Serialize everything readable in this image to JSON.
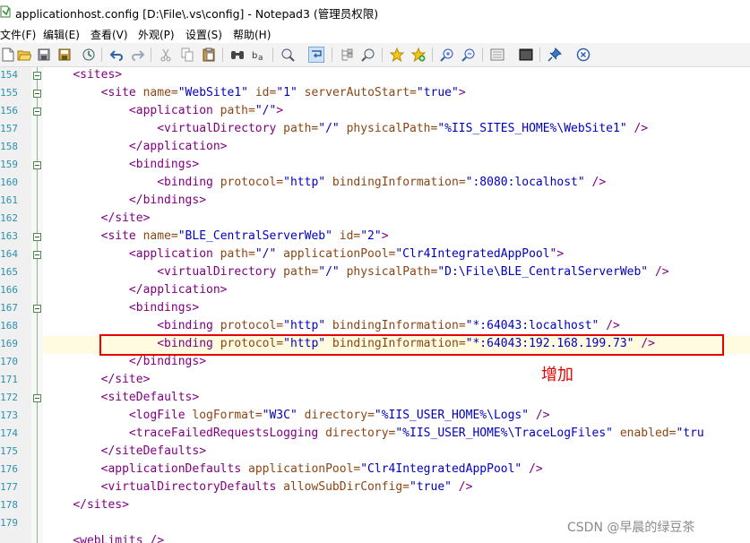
{
  "window": {
    "title": "applicationhost.config [D:\\File\\.vs\\config] - Notepad3  (管理员权限)"
  },
  "menu": [
    "文件(F)",
    "编辑(E)",
    "查看(V)",
    "外观(P)",
    "设置(S)",
    "帮助(H)"
  ],
  "toolbar": [
    "new-file-icon",
    "open-folder-icon",
    "save-icon",
    "save-as-icon",
    "browse-icon",
    "undo-icon",
    "redo-icon",
    "cut-icon",
    "copy-icon",
    "paste-icon",
    "find-icon",
    "replace-icon",
    "goto-icon",
    "word-wrap-icon",
    "view-icon",
    "zoom-icon",
    "favorite-icon",
    "add-favorite-icon",
    "zoom-in-icon",
    "zoom-out-icon",
    "page-setup-icon",
    "console-icon",
    "pin-icon",
    "exit-icon"
  ],
  "lines": [
    {
      "num": "154",
      "fold": true,
      "seg": [
        [
          "",
          "    "
        ],
        [
          "tg",
          "<sites>"
        ]
      ]
    },
    {
      "num": "155",
      "fold": true,
      "seg": [
        [
          "",
          "        "
        ],
        [
          "tg",
          "<site "
        ],
        [
          "at",
          "name="
        ],
        [
          "st",
          "\"WebSite1\""
        ],
        [
          "at",
          " id="
        ],
        [
          "st",
          "\"1\""
        ],
        [
          "at",
          " serverAutoStart="
        ],
        [
          "st",
          "\"true\""
        ],
        [
          "tg",
          ">"
        ]
      ]
    },
    {
      "num": "156",
      "fold": true,
      "seg": [
        [
          "",
          "            "
        ],
        [
          "tg",
          "<application "
        ],
        [
          "at",
          "path="
        ],
        [
          "st",
          "\"/\""
        ],
        [
          "tg",
          ">"
        ]
      ]
    },
    {
      "num": "157",
      "fold": false,
      "seg": [
        [
          "",
          "                "
        ],
        [
          "tg",
          "<virtualDirectory "
        ],
        [
          "at",
          "path="
        ],
        [
          "st",
          "\"/\""
        ],
        [
          "at",
          " physicalPath="
        ],
        [
          "st",
          "\"%IIS_SITES_HOME%\\WebSite1\""
        ],
        [
          "tg",
          " />"
        ]
      ]
    },
    {
      "num": "158",
      "fold": false,
      "seg": [
        [
          "",
          "            "
        ],
        [
          "tg",
          "</application>"
        ]
      ]
    },
    {
      "num": "159",
      "fold": true,
      "seg": [
        [
          "",
          "            "
        ],
        [
          "tg",
          "<bindings>"
        ]
      ]
    },
    {
      "num": "160",
      "fold": false,
      "seg": [
        [
          "",
          "                "
        ],
        [
          "tg",
          "<binding "
        ],
        [
          "at",
          "protocol="
        ],
        [
          "st",
          "\"http\""
        ],
        [
          "at",
          " bindingInformation="
        ],
        [
          "st",
          "\":8080:localhost\""
        ],
        [
          "tg",
          " />"
        ]
      ]
    },
    {
      "num": "161",
      "fold": false,
      "seg": [
        [
          "",
          "            "
        ],
        [
          "tg",
          "</bindings>"
        ]
      ]
    },
    {
      "num": "162",
      "fold": false,
      "seg": [
        [
          "",
          "        "
        ],
        [
          "tg",
          "</site>"
        ]
      ]
    },
    {
      "num": "163",
      "fold": true,
      "seg": [
        [
          "",
          "        "
        ],
        [
          "tg",
          "<site "
        ],
        [
          "at",
          "name="
        ],
        [
          "st",
          "\"BLE_CentralServerWeb\""
        ],
        [
          "at",
          " id="
        ],
        [
          "st",
          "\"2\""
        ],
        [
          "tg",
          ">"
        ]
      ]
    },
    {
      "num": "164",
      "fold": true,
      "seg": [
        [
          "",
          "            "
        ],
        [
          "tg",
          "<application "
        ],
        [
          "at",
          "path="
        ],
        [
          "st",
          "\"/\""
        ],
        [
          "at",
          " applicationPool="
        ],
        [
          "st",
          "\"Clr4IntegratedAppPool\""
        ],
        [
          "tg",
          ">"
        ]
      ]
    },
    {
      "num": "165",
      "fold": false,
      "seg": [
        [
          "",
          "                "
        ],
        [
          "tg",
          "<virtualDirectory "
        ],
        [
          "at",
          "path="
        ],
        [
          "st",
          "\"/\""
        ],
        [
          "at",
          " physicalPath="
        ],
        [
          "st",
          "\"D:\\File\\BLE_CentralServerWeb\""
        ],
        [
          "tg",
          " />"
        ]
      ]
    },
    {
      "num": "166",
      "fold": false,
      "seg": [
        [
          "",
          "            "
        ],
        [
          "tg",
          "</application>"
        ]
      ]
    },
    {
      "num": "167",
      "fold": true,
      "seg": [
        [
          "",
          "            "
        ],
        [
          "tg",
          "<bindings>"
        ]
      ]
    },
    {
      "num": "168",
      "fold": false,
      "seg": [
        [
          "",
          "                "
        ],
        [
          "tg",
          "<binding "
        ],
        [
          "at",
          "protocol="
        ],
        [
          "st",
          "\"http\""
        ],
        [
          "at",
          " bindingInformation="
        ],
        [
          "st",
          "\"*:64043:localhost\""
        ],
        [
          "tg",
          " />"
        ]
      ]
    },
    {
      "num": "169",
      "fold": false,
      "current": true,
      "seg": [
        [
          "",
          "                "
        ],
        [
          "tg",
          "<binding "
        ],
        [
          "at",
          "protocol="
        ],
        [
          "st",
          "\"http\""
        ],
        [
          "at",
          " bindingInformation="
        ],
        [
          "st",
          "\"*:64043:192.168.199.73\""
        ],
        [
          "tg",
          " />"
        ]
      ]
    },
    {
      "num": "170",
      "fold": false,
      "seg": [
        [
          "",
          "            "
        ],
        [
          "tg",
          "</bindings>"
        ]
      ]
    },
    {
      "num": "171",
      "fold": false,
      "seg": [
        [
          "",
          "        "
        ],
        [
          "tg",
          "</site>"
        ]
      ]
    },
    {
      "num": "172",
      "fold": true,
      "seg": [
        [
          "",
          "        "
        ],
        [
          "tg",
          "<siteDefaults>"
        ]
      ]
    },
    {
      "num": "173",
      "fold": false,
      "seg": [
        [
          "",
          "            "
        ],
        [
          "tg",
          "<logFile "
        ],
        [
          "at",
          "logFormat="
        ],
        [
          "st",
          "\"W3C\""
        ],
        [
          "at",
          " directory="
        ],
        [
          "st",
          "\"%IIS_USER_HOME%\\Logs\""
        ],
        [
          "tg",
          " />"
        ]
      ]
    },
    {
      "num": "174",
      "fold": false,
      "seg": [
        [
          "",
          "            "
        ],
        [
          "tg",
          "<traceFailedRequestsLogging "
        ],
        [
          "at",
          "directory="
        ],
        [
          "st",
          "\"%IIS_USER_HOME%\\TraceLogFiles\""
        ],
        [
          "at",
          " enabled="
        ],
        [
          "st",
          "\"tru"
        ]
      ]
    },
    {
      "num": "175",
      "fold": false,
      "seg": [
        [
          "",
          "        "
        ],
        [
          "tg",
          "</siteDefaults>"
        ]
      ]
    },
    {
      "num": "176",
      "fold": false,
      "seg": [
        [
          "",
          "        "
        ],
        [
          "tg",
          "<applicationDefaults "
        ],
        [
          "at",
          "applicationPool="
        ],
        [
          "st",
          "\"Clr4IntegratedAppPool\""
        ],
        [
          "tg",
          " />"
        ]
      ]
    },
    {
      "num": "177",
      "fold": false,
      "seg": [
        [
          "",
          "        "
        ],
        [
          "tg",
          "<virtualDirectoryDefaults "
        ],
        [
          "at",
          "allowSubDirConfig="
        ],
        [
          "st",
          "\"true\""
        ],
        [
          "tg",
          " />"
        ]
      ]
    },
    {
      "num": "178",
      "fold": false,
      "seg": [
        [
          "",
          "    "
        ],
        [
          "tg",
          "</sites>"
        ]
      ]
    },
    {
      "num": "179",
      "fold": false,
      "seg": [
        [
          "",
          ""
        ]
      ]
    },
    {
      "num": "",
      "fold": false,
      "seg": [
        [
          "",
          "    "
        ],
        [
          "tg",
          "<webLimits />"
        ]
      ]
    }
  ],
  "annotation": "增加",
  "watermark": "CSDN @早晨的绿豆茶"
}
